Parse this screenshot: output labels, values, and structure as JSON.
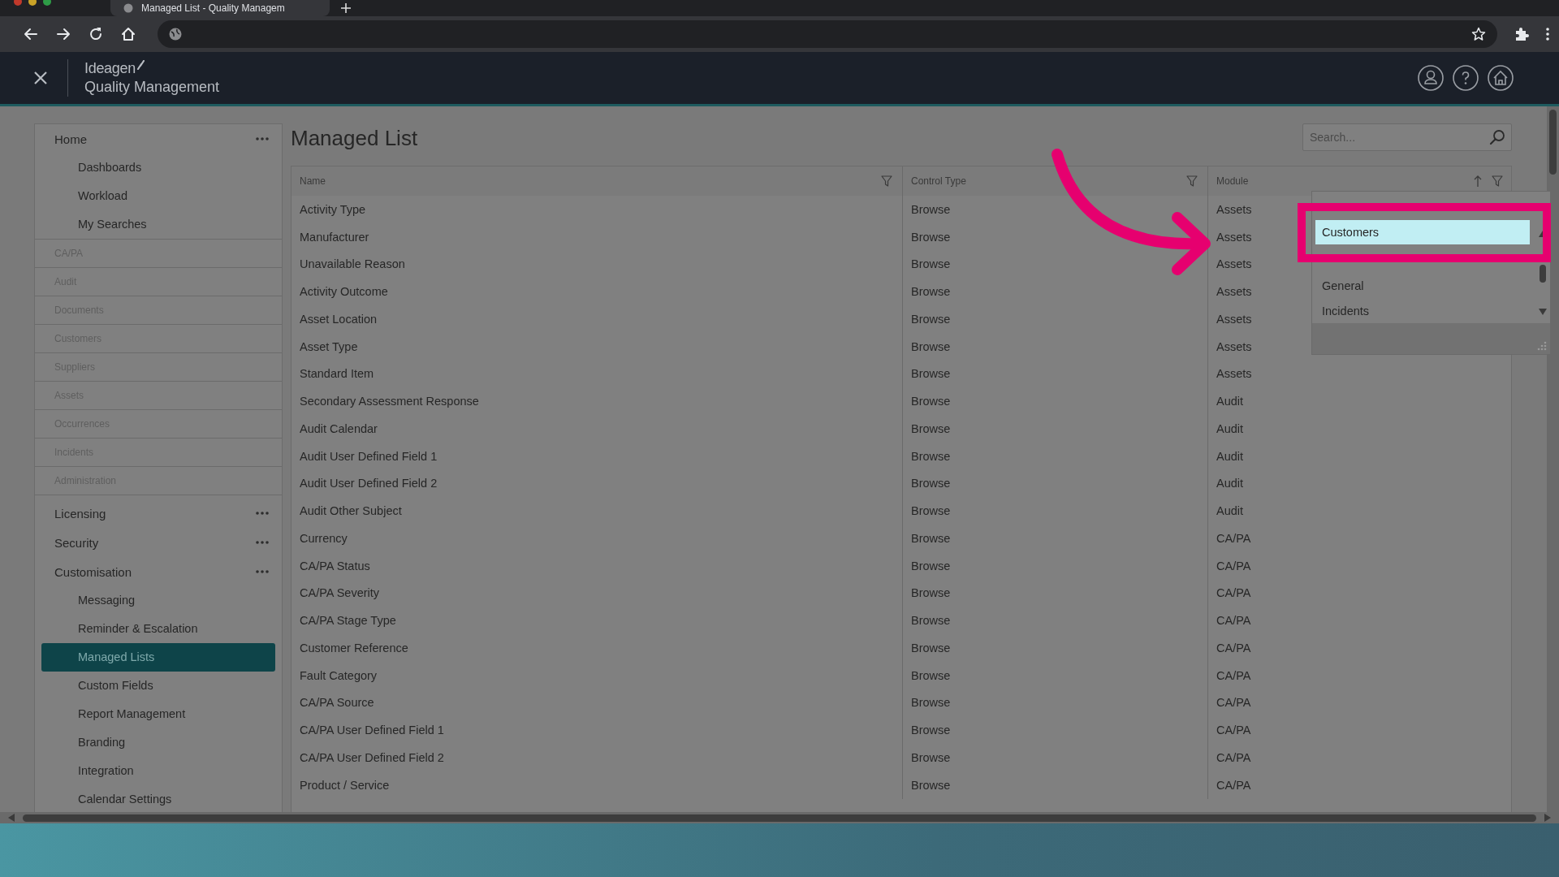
{
  "browser": {
    "tab_title": "Managed List - Quality Managem"
  },
  "app_header": {
    "brand": "Ideagen",
    "product": "Quality Management"
  },
  "sidebar": {
    "items": [
      {
        "label": "Home",
        "kind": "section",
        "menu": true,
        "children": [
          {
            "label": "Dashboards",
            "selected": false
          },
          {
            "label": "Workload",
            "selected": false
          },
          {
            "label": "My Searches",
            "selected": false
          }
        ]
      },
      {
        "label": "CA/PA",
        "kind": "module"
      },
      {
        "label": "Audit",
        "kind": "module"
      },
      {
        "label": "Documents",
        "kind": "module"
      },
      {
        "label": "Customers",
        "kind": "module"
      },
      {
        "label": "Suppliers",
        "kind": "module"
      },
      {
        "label": "Assets",
        "kind": "module"
      },
      {
        "label": "Occurrences",
        "kind": "module"
      },
      {
        "label": "Incidents",
        "kind": "module"
      },
      {
        "label": "Administration",
        "kind": "module"
      },
      {
        "label": "Licensing",
        "kind": "section",
        "menu": true
      },
      {
        "label": "Security",
        "kind": "section",
        "menu": true
      },
      {
        "label": "Customisation",
        "kind": "section",
        "menu": true,
        "children": [
          {
            "label": "Messaging",
            "selected": false
          },
          {
            "label": "Reminder & Escalation",
            "selected": false
          },
          {
            "label": "Managed Lists",
            "selected": true
          },
          {
            "label": "Custom Fields",
            "selected": false
          },
          {
            "label": "Report Management",
            "selected": false
          },
          {
            "label": "Branding",
            "selected": false
          },
          {
            "label": "Integration",
            "selected": false
          },
          {
            "label": "Calendar Settings",
            "selected": false
          }
        ]
      }
    ]
  },
  "page_title": "Managed List",
  "search": {
    "placeholder": "Search..."
  },
  "table": {
    "columns": [
      {
        "label": "Name",
        "sorted": false
      },
      {
        "label": "Control Type",
        "sorted": false
      },
      {
        "label": "Module",
        "sorted": true
      }
    ],
    "rows": [
      [
        "Activity Type",
        "Browse",
        "Assets"
      ],
      [
        "Manufacturer",
        "Browse",
        "Assets"
      ],
      [
        "Unavailable Reason",
        "Browse",
        "Assets"
      ],
      [
        "Activity Outcome",
        "Browse",
        "Assets"
      ],
      [
        "Asset Location",
        "Browse",
        "Assets"
      ],
      [
        "Asset Type",
        "Browse",
        "Assets"
      ],
      [
        "Standard Item",
        "Browse",
        "Assets"
      ],
      [
        "Secondary Assessment Response",
        "Browse",
        "Audit"
      ],
      [
        "Audit Calendar",
        "Browse",
        "Audit"
      ],
      [
        "Audit User Defined Field 1",
        "Browse",
        "Audit"
      ],
      [
        "Audit User Defined Field 2",
        "Browse",
        "Audit"
      ],
      [
        "Audit Other Subject",
        "Browse",
        "Audit"
      ],
      [
        "Currency",
        "Browse",
        "CA/PA"
      ],
      [
        "CA/PA Status",
        "Browse",
        "CA/PA"
      ],
      [
        "CA/PA Severity",
        "Browse",
        "CA/PA"
      ],
      [
        "CA/PA Stage Type",
        "Browse",
        "CA/PA"
      ],
      [
        "Customer Reference",
        "Browse",
        "CA/PA"
      ],
      [
        "Fault Category",
        "Browse",
        "CA/PA"
      ],
      [
        "CA/PA Source",
        "Browse",
        "CA/PA"
      ],
      [
        "CA/PA User Defined Field 1",
        "Browse",
        "CA/PA"
      ],
      [
        "CA/PA User Defined Field 2",
        "Browse",
        "CA/PA"
      ],
      [
        "Product / Service",
        "Browse",
        "CA/PA"
      ]
    ]
  },
  "dropdown": {
    "items": [
      {
        "label": "Customers",
        "selected": true
      },
      {
        "label": "General",
        "selected": false
      },
      {
        "label": "Incidents",
        "selected": false
      }
    ]
  }
}
